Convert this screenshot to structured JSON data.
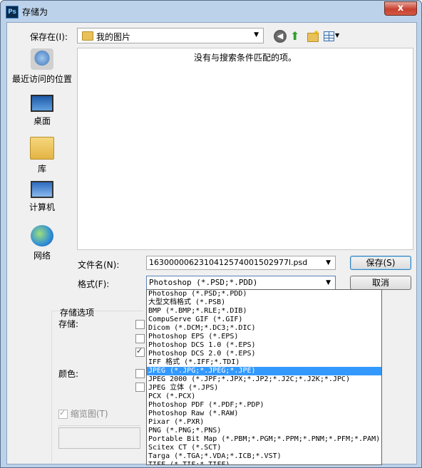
{
  "window": {
    "title": "存储为",
    "app_icon": "Ps",
    "close_label": "x"
  },
  "toolbar": {
    "save_in_label": "保存在(I):",
    "current_folder": "我的图片"
  },
  "places": [
    {
      "label": "最近访问的位置",
      "icon": "recent-places-icon"
    },
    {
      "label": "桌面",
      "icon": "desktop-icon"
    },
    {
      "label": "库",
      "icon": "libraries-icon"
    },
    {
      "label": "计算机",
      "icon": "computer-icon"
    },
    {
      "label": "网络",
      "icon": "network-icon"
    }
  ],
  "file_list": {
    "empty_message": "没有与搜索条件匹配的项。"
  },
  "filename": {
    "label": "文件名(N):",
    "value": "1630000062310412574001502977l.psd"
  },
  "format": {
    "label": "格式(F):",
    "value": "Photoshop (*.PSD;*.PDD)"
  },
  "buttons": {
    "save": "保存(S)",
    "cancel": "取消"
  },
  "format_options": [
    "Photoshop (*.PSD;*.PDD)",
    "大型文档格式 (*.PSB)",
    "BMP (*.BMP;*.RLE;*.DIB)",
    "CompuServe GIF (*.GIF)",
    "Dicom (*.DCM;*.DC3;*.DIC)",
    "Photoshop EPS (*.EPS)",
    "Photoshop DCS 1.0 (*.EPS)",
    "Photoshop DCS 2.0 (*.EPS)",
    "IFF 格式 (*.IFF;*.TDI)",
    "JPEG (*.JPG;*.JPEG;*.JPE)",
    "JPEG 2000 (*.JPF;*.JPX;*.JP2;*.J2C;*.J2K;*.JPC)",
    "JPEG 立体 (*.JPS)",
    "PCX (*.PCX)",
    "Photoshop PDF (*.PDF;*.PDP)",
    "Photoshop Raw (*.RAW)",
    "Pixar (*.PXR)",
    "PNG (*.PNG;*.PNS)",
    "Portable Bit Map (*.PBM;*.PGM;*.PPM;*.PNM;*.PFM;*.PAM)",
    "Scitex CT (*.SCT)",
    "Targa (*.TGA;*.VDA;*.ICB;*.VST)",
    "TIFF (*.TIF;*.TIFF)"
  ],
  "selected_format_index": 9,
  "save_options": {
    "section_title": "存储选项",
    "save_label": "存储:",
    "color_label": "颜色:",
    "thumbnail_label": "缩览图(T)"
  }
}
